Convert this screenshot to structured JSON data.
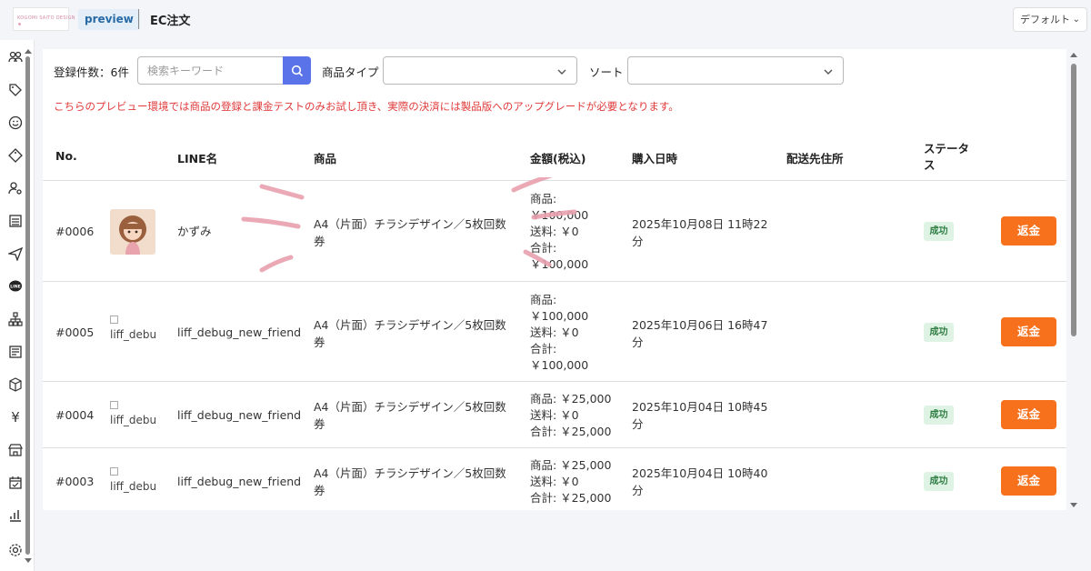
{
  "header": {
    "logo_text": "KOGOMI SAITO DESIGN",
    "preview_label": "preview",
    "title": "EC注文",
    "default_select": "デフォルト"
  },
  "sidebar": {
    "icons": [
      "users-icon",
      "tag-icon",
      "smile-icon",
      "diamond-tag-icon",
      "user-settings-icon",
      "list-icon",
      "send-icon",
      "line-icon",
      "sitemap-icon",
      "document-list-icon",
      "box-icon",
      "yen-icon",
      "store-icon",
      "calendar-check-icon",
      "bar-chart-icon",
      "settings-icon"
    ]
  },
  "toolbar": {
    "count_label": "登録件数：6件",
    "search_placeholder": "検索キーワード",
    "product_type_label": "商品タイプ",
    "sort_label": "ソート"
  },
  "notice": "こちらのプレビュー環境では商品の登録と課金テストのみお試し頂き、実際の決済には製品版へのアップグレードが必要となります。",
  "table": {
    "headers": {
      "no": "No.",
      "line_name": "LINE名",
      "product": "商品",
      "amount": "金額(税込)",
      "purchase_date": "購入日時",
      "shipping": "配送先住所",
      "status": "ステータス"
    },
    "rows": [
      {
        "no": "#0006",
        "image_alt": "",
        "line_name": "かずみ",
        "product": "A4（片面）チラシデザイン／5枚回数券",
        "amount_product": "商品:",
        "amount_product_value": "￥100,000",
        "amount_shipping": "送料: ￥0",
        "amount_total": "合計:",
        "amount_total_value": "￥100,000",
        "purchase_date": "2025年10月08日 11時22分",
        "status": "成功",
        "refund": "返金"
      },
      {
        "no": "#0005",
        "image_alt": "liff_debu",
        "line_name": "liff_debug_new_friend",
        "product": "A4（片面）チラシデザイン／5枚回数券",
        "amount_product": "商品:",
        "amount_product_value": "￥100,000",
        "amount_shipping": "送料: ￥0",
        "amount_total": "合計:",
        "amount_total_value": "￥100,000",
        "purchase_date": "2025年10月06日 16時47分",
        "status": "成功",
        "refund": "返金"
      },
      {
        "no": "#0004",
        "image_alt": "liff_debu",
        "line_name": "liff_debug_new_friend",
        "product": "A4（片面）チラシデザイン／5枚回数券",
        "amount_product": "商品: ￥25,000",
        "amount_shipping": "送料: ￥0",
        "amount_total": "合計: ￥25,000",
        "purchase_date": "2025年10月04日 10時45分",
        "status": "成功",
        "refund": "返金"
      },
      {
        "no": "#0003",
        "image_alt": "liff_debu",
        "line_name": "liff_debug_new_friend",
        "product": "A4（片面）チラシデザイン／5枚回数券",
        "amount_product": "商品: ￥25,000",
        "amount_shipping": "送料: ￥0",
        "amount_total": "合計: ￥25,000",
        "purchase_date": "2025年10月04日 10時40分",
        "status": "成功",
        "refund": "返金"
      }
    ]
  },
  "colors": {
    "accent": "#5b73e8",
    "refund": "#f7711c",
    "notice": "#e03a3a",
    "success_bg": "#dff3e4",
    "success_text": "#2e7d42"
  }
}
